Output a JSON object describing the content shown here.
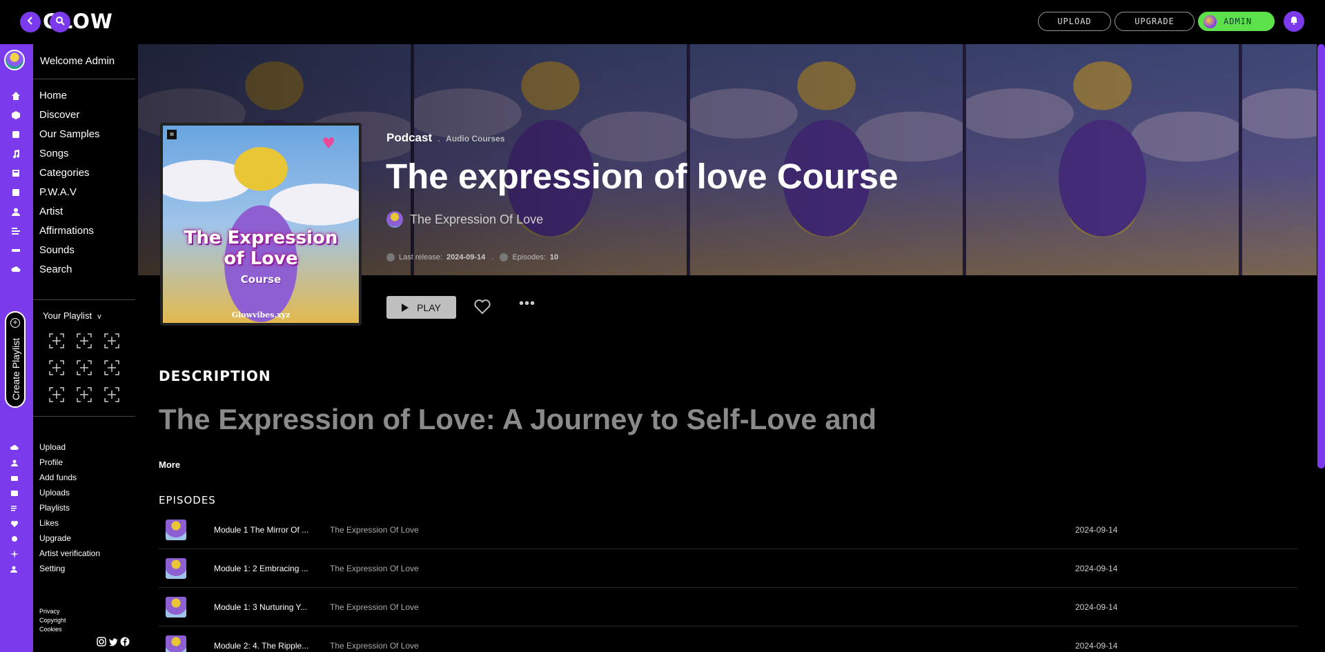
{
  "app": {
    "logo_text": "GLOW",
    "accent": "#7c3aed",
    "admin_green": "#5de14b"
  },
  "topbar": {
    "back_icon": "chevron-left-icon",
    "search_icon": "search-icon",
    "upload_label": "UPLOAD",
    "upgrade_label": "UPGRADE",
    "admin_label": "ADMIN",
    "bell_icon": "bell-icon"
  },
  "sidebar": {
    "welcome": "Welcome Admin",
    "nav": [
      "Home",
      "Discover",
      "Our Samples",
      "Songs",
      "Categories",
      "P.W.A.V",
      "Artist",
      "Affirmations",
      "Sounds",
      "Search"
    ],
    "playlist_title": "Your Playlist",
    "playlist_chevron": "v",
    "create_playlist": "Create Playlist",
    "sub_nav": [
      "Upload",
      "Profile",
      "Add funds",
      "Uploads",
      "Playlists",
      "Likes",
      "Upgrade",
      "Artist verification",
      "Setting"
    ],
    "legal": [
      "Privacy",
      "Copyright",
      "Cookies"
    ],
    "social_icons": [
      "instagram-icon",
      "twitter-icon",
      "facebook-icon"
    ]
  },
  "album": {
    "type": "Podcast",
    "category": "Audio Courses",
    "title": "The expression of love Course",
    "artist": "The Expression Of Love",
    "last_release_label": "Last release:",
    "last_release": "2024-09-14",
    "episodes_label": "Episodes:",
    "episodes_count": "10",
    "cover_line1": "The Expression",
    "cover_line2": "of Love",
    "cover_line3": "Course",
    "cover_brand": "Glowvibes.xyz",
    "play_label": "PLAY",
    "more_label": "•••"
  },
  "description": {
    "heading": "DESCRIPTION",
    "text": "The Expression of Love: A Journey to Self-Love and",
    "more": "More"
  },
  "episodes": {
    "heading": "EPISODES",
    "rows": [
      {
        "title": "Module 1 The Mirror Of ...",
        "artist": "The Expression Of Love",
        "date": "2024-09-14"
      },
      {
        "title": "Module 1: 2 Embracing ...",
        "artist": "The Expression Of Love",
        "date": "2024-09-14"
      },
      {
        "title": "Module 1: 3 Nurturing Y...",
        "artist": "The Expression Of Love",
        "date": "2024-09-14"
      },
      {
        "title": "Module 2: 4. The Ripple...",
        "artist": "The Expression Of Love",
        "date": "2024-09-14"
      }
    ]
  }
}
